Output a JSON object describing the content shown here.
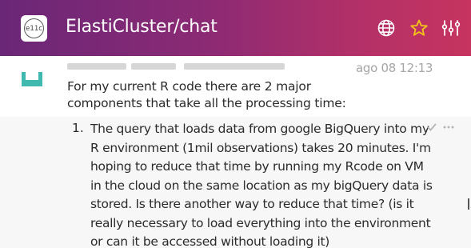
{
  "header": {
    "room_avatar_text": "e11c",
    "room_name": "ElastiCluster/chat",
    "icons": [
      "globe-icon",
      "star-icon",
      "settings-sliders-icon"
    ],
    "star_color": "#f5c518"
  },
  "message": {
    "timestamp": "ago 08 12:13",
    "text": "For my current R code there are 2 major components that take all the processing time:",
    "list_item_number": "1.",
    "list_item_text": "The query that loads data from google BigQuery into my R environment (1mil observations) takes 20 minutes. I'm hoping to reduce that time by running my Rcode on VM in the cloud on the same location as my bigQuery data is stored. Is there another way to reduce that time? (is it really necessary to load everything into the environment or can it be accessed without loading it)"
  },
  "colors": {
    "avatar_teal": "#3fb8b0",
    "header_gradient_start": "#6a2777",
    "header_gradient_end": "#c6345f"
  }
}
